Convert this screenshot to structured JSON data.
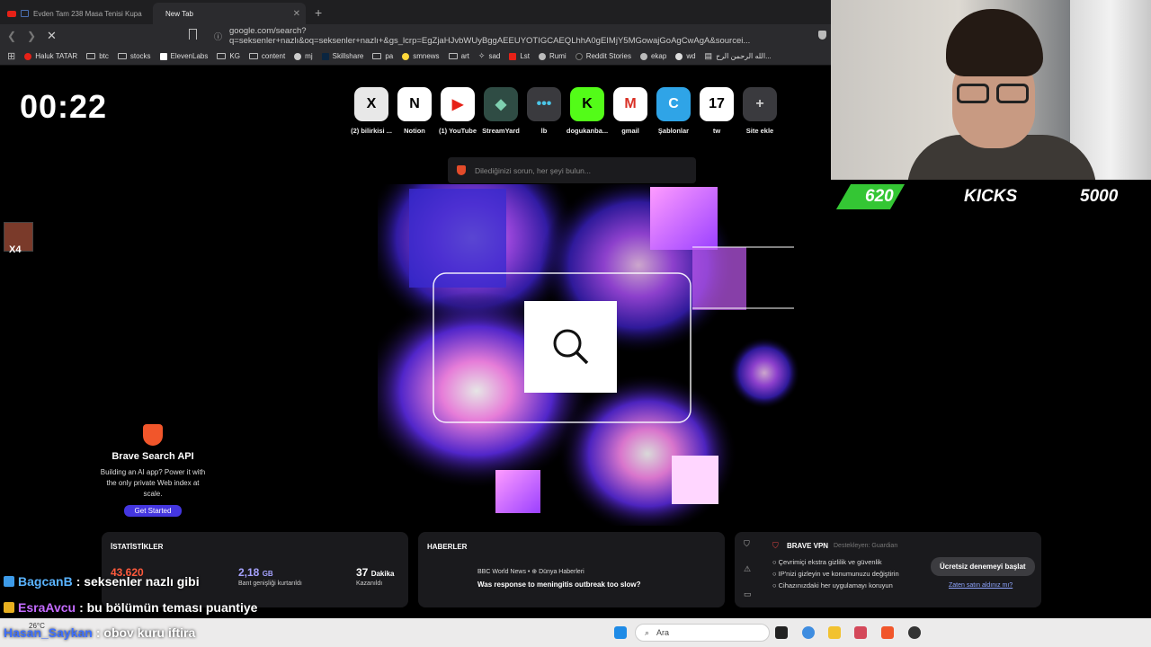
{
  "tabs": [
    {
      "label": "Evden Tam 238 Masa Tenisi Kupa",
      "active": false
    },
    {
      "label": "New Tab",
      "active": true
    }
  ],
  "address_bar": {
    "url": "google.com/search?q=seksenler+nazlı&oq=seksenler+nazlı+&gs_lcrp=EgZjaHJvbWUyBggAEEUYOTIGCAEQLhhA0gEIMjY5MGowajGoAgCwAgA&sourcei..."
  },
  "bookmarks": [
    "Haluk TATAR",
    "btc",
    "stocks",
    "ElevenLabs",
    "KG",
    "content",
    "mj",
    "Skillshare",
    "pa",
    "smnews",
    "art",
    "sad",
    "Lst",
    "Rumi",
    "Reddit Stories",
    "ekap",
    "wd",
    "الله الرحمن الرح..."
  ],
  "clock": "00:22",
  "top_sites": [
    {
      "label": "(2) bilirkisi ...",
      "glyph": "X",
      "bg": "#e8e8e8",
      "fg": "#000"
    },
    {
      "label": "Notion",
      "glyph": "N",
      "bg": "#ffffff",
      "fg": "#000"
    },
    {
      "label": "(1) YouTube",
      "glyph": "▶",
      "bg": "#ffffff",
      "fg": "#e62117"
    },
    {
      "label": "StreamYard",
      "glyph": "◆",
      "bg": "#2f4c44",
      "fg": "#7fd0b0"
    },
    {
      "label": "lb",
      "glyph": "•••",
      "bg": "#3a3a3e",
      "fg": "#4bc6e8"
    },
    {
      "label": "dogukanba...",
      "glyph": "K",
      "bg": "#53fc18",
      "fg": "#000"
    },
    {
      "label": "gmail",
      "glyph": "M",
      "bg": "#ffffff",
      "fg": "#d93025"
    },
    {
      "label": "Şablonlar",
      "glyph": "C",
      "bg": "#2fa4e7",
      "fg": "#fff"
    },
    {
      "label": "tw",
      "glyph": "17",
      "bg": "#ffffff",
      "fg": "#000"
    },
    {
      "label": "Site ekle",
      "glyph": "+",
      "bg": "#3a3a3e",
      "fg": "#ccc"
    }
  ],
  "search": {
    "placeholder": "Dilediğinizi sorun, her şeyi bulun..."
  },
  "promo": {
    "title": "Brave Search API",
    "text": "Building an AI app? Power it with the only private Web index at scale.",
    "button": "Get Started"
  },
  "stats": {
    "title": "İSTATİSTİKLER",
    "items": [
      {
        "value": "43.620",
        "unit": "",
        "label": "",
        "color": "#ff5a3c"
      },
      {
        "value": "2,18",
        "unit": "GB",
        "label": "Bant genişliği kurtarıldı",
        "color": "#a6a3ff"
      },
      {
        "value": "37",
        "unit": "Dakika",
        "label": "Kazanıldı",
        "color": "#ffffff"
      }
    ]
  },
  "news": {
    "title": "HABERLER",
    "source": "BBC World News",
    "category": "Dünya Haberleri",
    "headline": "Was response to meningitis outbreak too slow?"
  },
  "vpn": {
    "title": "BRAVE VPN",
    "supporter": "Destekleyen: Guardian",
    "features": [
      "Çevrimiçi ekstra gizlilik ve güvenlik",
      "IP'nizi gizleyin ve konumunuzu değiştirin",
      "Cihazınızdaki her uygulamayı koruyun"
    ],
    "button": "Ücretsiz denemeyi başlat",
    "link": "Zaten satın aldınız mı?"
  },
  "overlay": {
    "kicks": {
      "count": "620",
      "label": "KICKS",
      "goal": "5000"
    },
    "avatar_badge": "X4",
    "chat": [
      {
        "user": "BagcanB",
        "user_color": "#5ab4ff",
        "message": ": seksenler nazlı gibi",
        "badge_color": "#3d9be9"
      },
      {
        "user": "EsraAvcu",
        "user_color": "#c46bff",
        "message": ": bu bölümün teması puantiye",
        "badge_color": "#e8b020"
      },
      {
        "user": "Hasan_Saykan",
        "user_color": "#3d6fff",
        "message": ": obov kuru iftira",
        "badge_color": ""
      }
    ]
  },
  "taskbar": {
    "search": "Ara",
    "weather": "26°C"
  }
}
